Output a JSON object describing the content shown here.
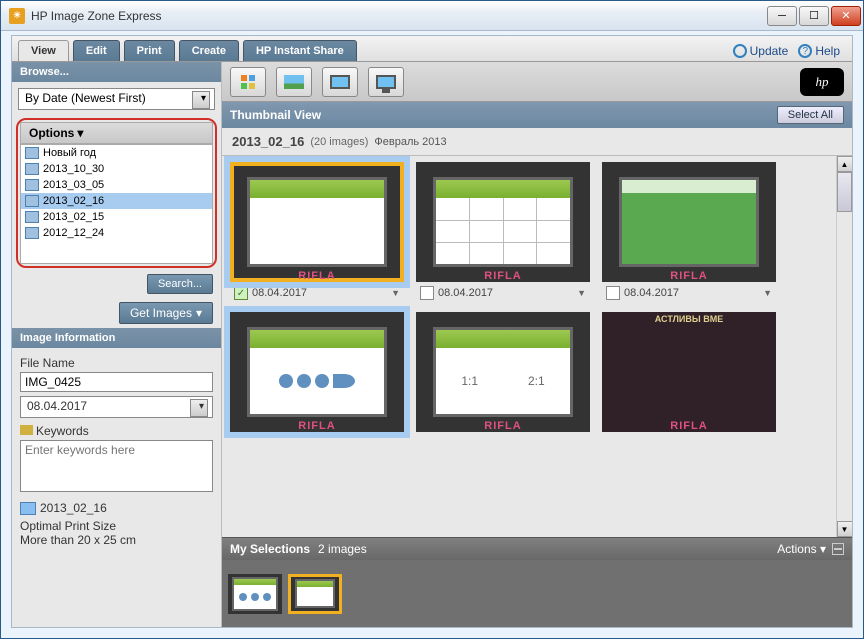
{
  "window": {
    "title": "HP Image Zone Express"
  },
  "tabs": {
    "view": "View",
    "edit": "Edit",
    "print": "Print",
    "create": "Create",
    "share": "HP Instant Share"
  },
  "header_links": {
    "update": "Update",
    "help": "Help"
  },
  "sidebar": {
    "browse_hdr": "Browse...",
    "sort_mode": "By Date (Newest First)",
    "options_hdr": "Options",
    "tree": [
      {
        "label": "Новый год"
      },
      {
        "label": "2013_10_30"
      },
      {
        "label": "2013_03_05"
      },
      {
        "label": "2013_02_16",
        "selected": true
      },
      {
        "label": "2013_02_15"
      },
      {
        "label": "2012_12_24"
      }
    ],
    "search_btn": "Search...",
    "get_images_btn": "Get Images",
    "info_hdr": "Image Information",
    "filename_label": "File Name",
    "filename": "IMG_0425",
    "date": "08.04.2017",
    "keywords_label": "Keywords",
    "keywords_placeholder": "Enter keywords here",
    "folder": "2013_02_16",
    "print_size_label": "Optimal Print Size",
    "print_size": "More than 20 x 25 cm"
  },
  "main": {
    "view_title": "Thumbnail View",
    "select_all": "Select All",
    "group_name": "2013_02_16",
    "group_count": "(20 images)",
    "group_sub": "Февраль 2013",
    "thumb_date": "08.04.2017"
  },
  "selections": {
    "title": "My Selections",
    "count": "2 images",
    "actions": "Actions"
  },
  "logo": "hp"
}
